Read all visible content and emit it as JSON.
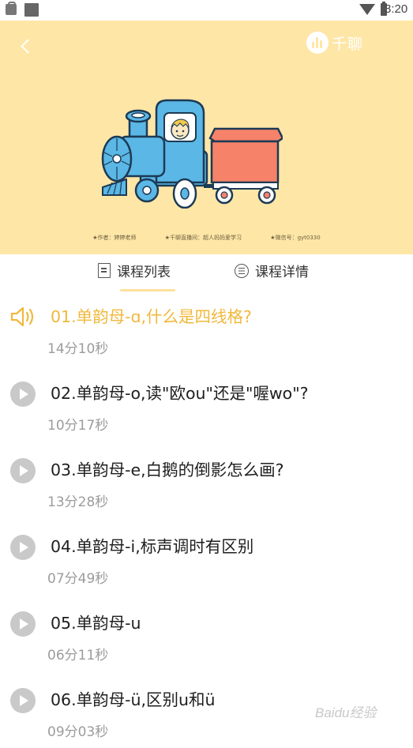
{
  "status_bar": {
    "time": "3:20"
  },
  "banner": {
    "brand": "千聊",
    "credits": [
      "★作者：婷婷老师",
      "★千聊直播间：超人妈妈爱学习",
      "★微信号：gyt0330"
    ],
    "background_color": "#fee6a6",
    "illustration": "cartoon-train"
  },
  "tabs": [
    {
      "label": "课程列表",
      "icon": "book-icon",
      "selected": true
    },
    {
      "label": "课程详情",
      "icon": "list-icon",
      "selected": false
    }
  ],
  "lessons": [
    {
      "title": "01.单韵母-ɑ,什么是四线格?",
      "duration": "14分10秒",
      "state": "playing",
      "icon": "speaker-icon"
    },
    {
      "title": "02.单韵母-o,读\"欧ou\"还是\"喔wo\"?",
      "duration": "10分17秒",
      "state": "idle",
      "icon": "play-icon"
    },
    {
      "title": "03.单韵母-e,白鹅的倒影怎么画?",
      "duration": "13分28秒",
      "state": "idle",
      "icon": "play-icon"
    },
    {
      "title": "04.单韵母-i,标声调时有区别",
      "duration": "07分49秒",
      "state": "idle",
      "icon": "play-icon"
    },
    {
      "title": "05.单韵母-u",
      "duration": "06分11秒",
      "state": "idle",
      "icon": "play-icon"
    },
    {
      "title": "06.单韵母-ü,区别u和ü",
      "duration": "09分03秒",
      "state": "idle",
      "icon": "play-icon"
    }
  ],
  "colors": {
    "accent": "#f1b83c",
    "tab_indicator": "#fde19c",
    "duration_text": "#9c9c9c"
  },
  "watermark": "Baidu经验"
}
